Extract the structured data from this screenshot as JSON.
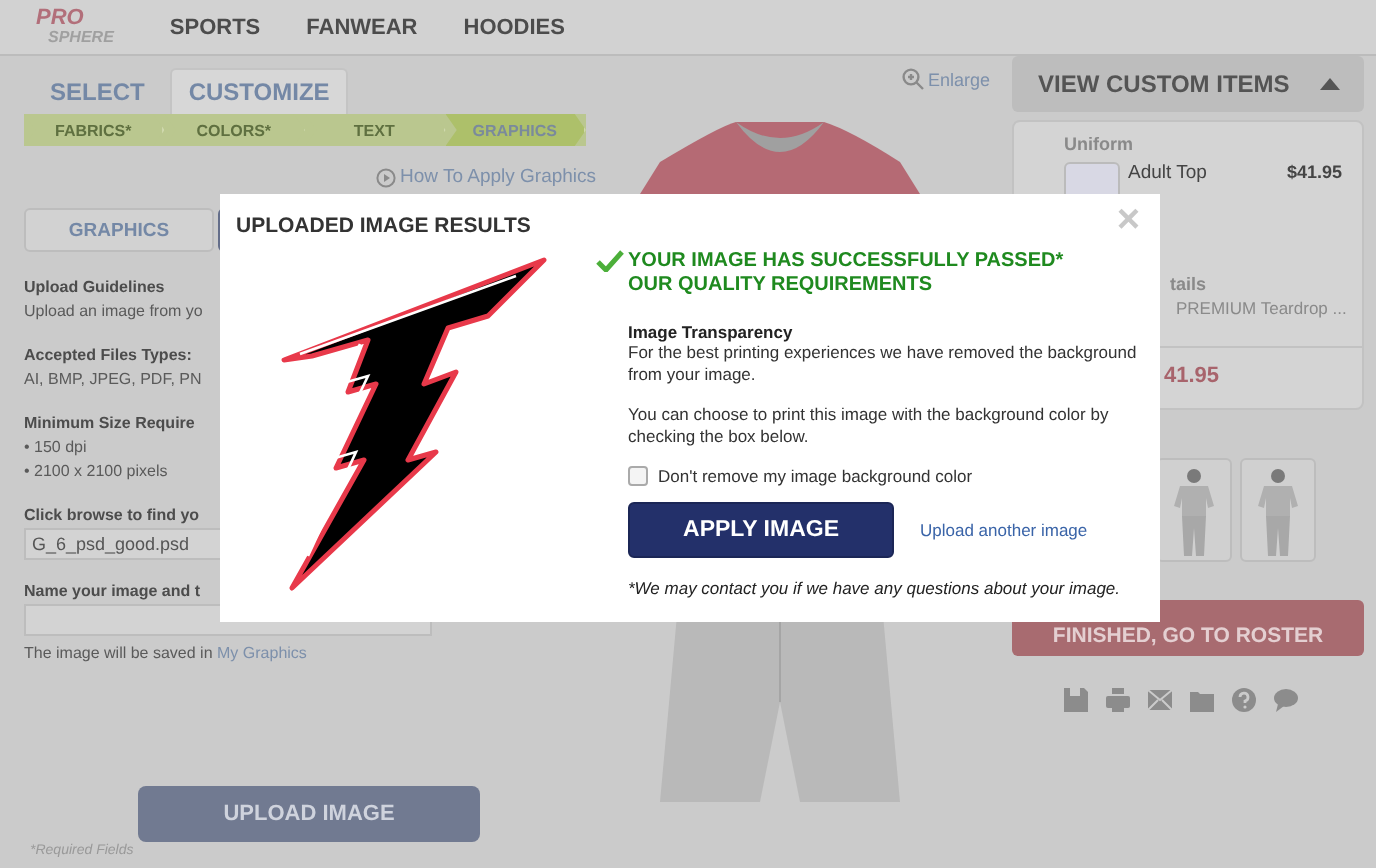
{
  "header": {
    "logo": {
      "top": "PRO",
      "bottom": "SPHERE"
    },
    "nav": [
      "SPORTS",
      "FANWEAR",
      "HOODIES"
    ]
  },
  "mode_tabs": [
    {
      "label": "SELECT",
      "selected": false
    },
    {
      "label": "CUSTOMIZE",
      "selected": true
    }
  ],
  "steps": [
    {
      "label": "FABRICS*",
      "selected": false
    },
    {
      "label": "COLORS*",
      "selected": false
    },
    {
      "label": "TEXT",
      "selected": false
    },
    {
      "label": "GRAPHICS",
      "selected": true
    }
  ],
  "help_link": "How To Apply Graphics",
  "enlarge_link": "Enlarge",
  "panel_tabs": [
    {
      "label": "GRAPHICS",
      "selected": false
    },
    {
      "selected": true
    }
  ],
  "guidelines": [
    {
      "heading": "Upload Guidelines",
      "lines": [
        "Upload an image from yo"
      ]
    },
    {
      "heading": "Accepted Files Types:",
      "lines": [
        "AI, BMP, JPEG, PDF, PN"
      ]
    },
    {
      "heading": "Minimum Size Require",
      "lines": [
        "• 150 dpi",
        "• 2100 x 2100 pixels"
      ]
    }
  ],
  "file_field": {
    "label": "Click browse to find yo",
    "value": "G_6_psd_good.psd"
  },
  "name_field": {
    "label": "Name your image and t"
  },
  "saved_note": {
    "text": "The image will be saved in",
    "link": "My Graphics"
  },
  "upload_button": "UPLOAD IMAGE",
  "required_note": "*Required Fields",
  "custom_items": {
    "title": "VIEW CUSTOM ITEMS",
    "expanded": true,
    "category": "Uniform",
    "item": "Adult Top",
    "price": "$41.95",
    "details_label": "tails",
    "details_value": "PREMIUM Teardrop ...",
    "total": "41.95"
  },
  "finish_button": "FINISHED, GO TO ROSTER",
  "modal": {
    "title": "UPLOADED IMAGE RESULTS",
    "close": "×",
    "message": "YOUR IMAGE HAS SUCCESSFULLY PASSED* OUR QUALITY REQUIREMENTS",
    "heading": "Image Transparency",
    "paragraphs": [
      "For the best printing experiences we have removed the background from your image.",
      "You can choose to print this image with the background color by checking the box below."
    ],
    "checkbox": {
      "label": "Don't remove my image background color",
      "checked": false
    },
    "apply_button": "APPLY IMAGE",
    "upload_link": "Upload another image",
    "footnote": "*We may contact you if we have any questions about your image."
  }
}
